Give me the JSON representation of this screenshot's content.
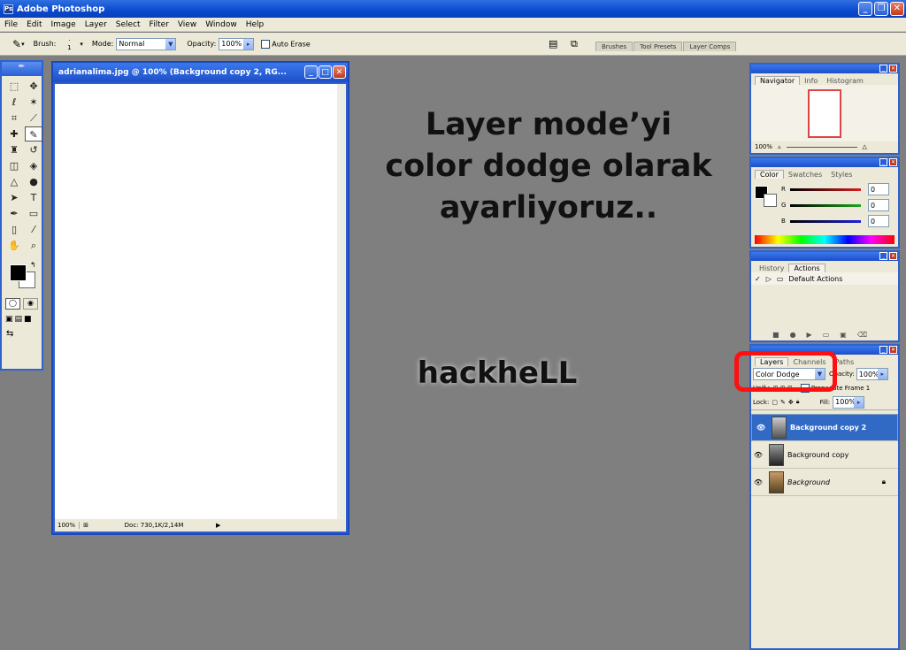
{
  "app": {
    "title": "Adobe Photoshop"
  },
  "menu": [
    "File",
    "Edit",
    "Image",
    "Layer",
    "Select",
    "Filter",
    "View",
    "Window",
    "Help"
  ],
  "options": {
    "brush_label": "Brush:",
    "brush_size": "1",
    "mode_label": "Mode:",
    "mode_value": "Normal",
    "opacity_label": "Opacity:",
    "opacity_value": "100%",
    "auto_erase": "Auto Erase"
  },
  "palette_well": [
    "Brushes",
    "Tool Presets",
    "Layer Comps"
  ],
  "document": {
    "title": "adrianalima.jpg @ 100% (Background copy 2, RG...",
    "zoom": "100%",
    "doc_info": "Doc: 730,1K/2,14M"
  },
  "annotation": {
    "line1": "Layer mode’yi",
    "line2": "color dodge olarak",
    "line3": "ayarliyoruz..",
    "signature": "hackheLL"
  },
  "navigator": {
    "tabs": [
      "Navigator",
      "Info",
      "Histogram"
    ],
    "zoom": "100%"
  },
  "color": {
    "tabs": [
      "Color",
      "Swatches",
      "Styles"
    ],
    "channels": [
      {
        "name": "R",
        "value": "0",
        "color": "#d81e1e"
      },
      {
        "name": "G",
        "value": "0",
        "color": "#1ea81e"
      },
      {
        "name": "B",
        "value": "0",
        "color": "#1e1ed8"
      }
    ]
  },
  "history": {
    "tabs": [
      "History",
      "Actions"
    ],
    "action_set": "Default Actions"
  },
  "layers": {
    "tabs": [
      "Layers",
      "Channels",
      "Paths"
    ],
    "blend_mode": "Color Dodge",
    "opacity_label": "Opacity:",
    "opacity_value": "100%",
    "unify_label": "Unify:",
    "propagate": "Propagate Frame 1",
    "lock_label": "Lock:",
    "fill_label": "Fill:",
    "fill_value": "100%",
    "items": [
      {
        "name": "Background copy 2",
        "selected": true
      },
      {
        "name": "Background copy",
        "selected": false
      },
      {
        "name": "Background",
        "selected": false
      }
    ]
  }
}
